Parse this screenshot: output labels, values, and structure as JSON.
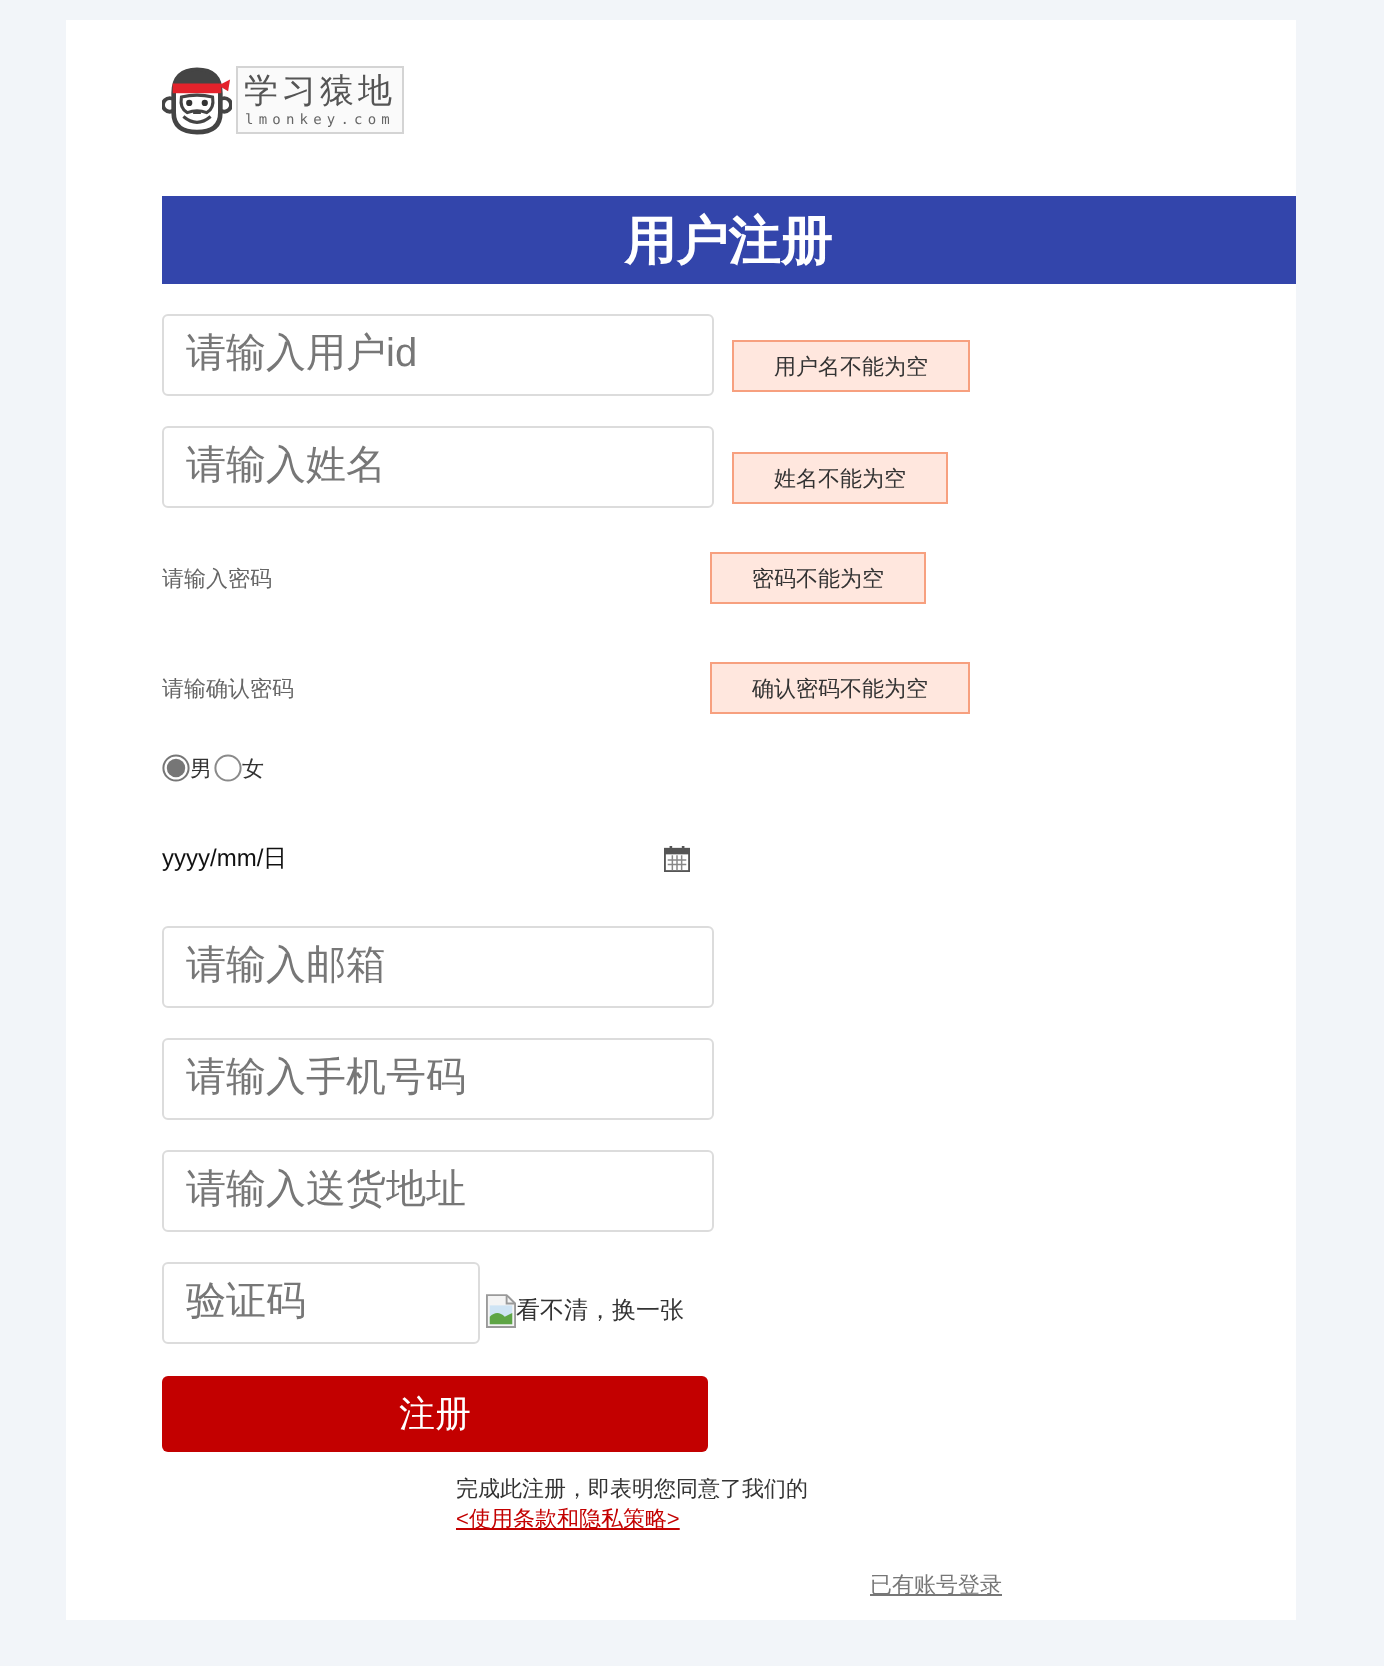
{
  "logo": {
    "title": "学习猿地",
    "subtitle": "lmonkey.com"
  },
  "heading": "用户注册",
  "fields": [
    {
      "kind": "text",
      "placeholder": "请输入用户id",
      "error": "用户名不能为空"
    },
    {
      "kind": "text",
      "placeholder": "请输入姓名",
      "error": "姓名不能为空"
    },
    {
      "kind": "plain",
      "placeholder": "请输入密码",
      "error": "密码不能为空"
    },
    {
      "kind": "plain",
      "placeholder": "请输确认密码",
      "error": "确认密码不能为空"
    },
    {
      "kind": "radio",
      "options": [
        {
          "label": "男",
          "selected": true
        },
        {
          "label": "女",
          "selected": false
        }
      ]
    },
    {
      "kind": "date",
      "placeholder": "yyyy/mm/日"
    },
    {
      "kind": "text",
      "placeholder": "请输入邮箱"
    },
    {
      "kind": "text",
      "placeholder": "请输入手机号码"
    },
    {
      "kind": "text",
      "placeholder": "请输入送货地址"
    },
    {
      "kind": "captcha",
      "placeholder": "验证码",
      "refresh": "看不清，换一张"
    }
  ],
  "submit": "注册",
  "agreement": {
    "text": "完成此注册，即表明您同意了我们的",
    "link": "<使用条款和隐私策略>"
  },
  "login_link": "已有账号登录"
}
